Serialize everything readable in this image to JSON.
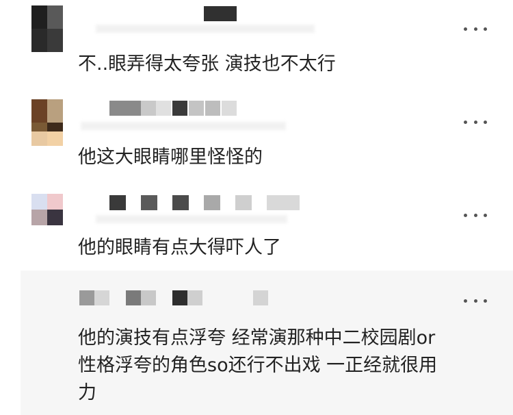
{
  "comments": [
    {
      "text": "不..眼弄得太夸张 演技也不太行",
      "more": "more-options"
    },
    {
      "text": "他这大眼睛哪里怪怪的",
      "more": "more-options"
    },
    {
      "text": "他的眼睛有点大得吓人了",
      "more": "more-options"
    },
    {
      "text": "他的演技有点浮夸 经常演那种中二校园剧or\n性格浮夸的角色so还行不出戏 一正经就很用\n力",
      "more": "more-options"
    }
  ],
  "colors": {
    "text": "#222222",
    "icon": "#555555",
    "background": "#ffffff"
  }
}
